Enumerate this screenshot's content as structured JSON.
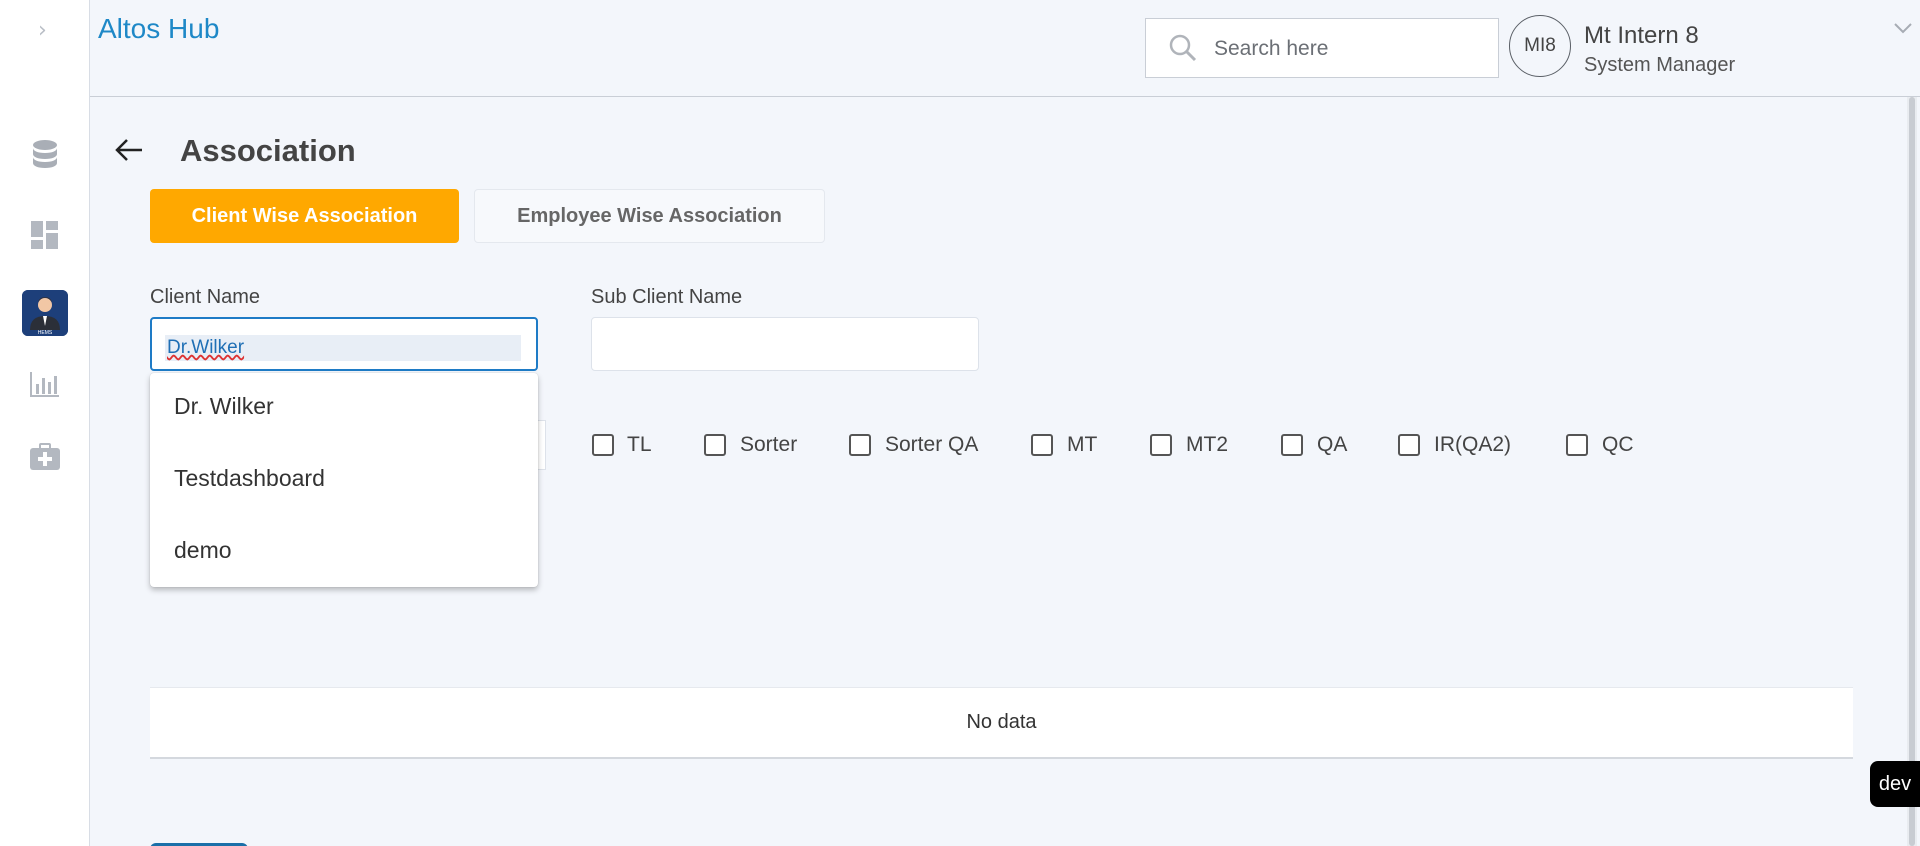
{
  "app": {
    "title": "Altos Hub"
  },
  "header": {
    "search_placeholder": "Search here",
    "user": {
      "initials": "MI8",
      "name": "Mt Intern 8",
      "role": "System Manager"
    }
  },
  "sidebar": {
    "items": [
      {
        "icon": "database-icon"
      },
      {
        "icon": "dashboard-icon"
      },
      {
        "icon": "hems-avatar-icon",
        "label": "HEMS"
      },
      {
        "icon": "bar-chart-icon"
      },
      {
        "icon": "medical-kit-icon"
      }
    ]
  },
  "page": {
    "title": "Association",
    "tabs": [
      {
        "label": "Client Wise Association",
        "active": true
      },
      {
        "label": "Employee Wise Association",
        "active": false
      }
    ]
  },
  "form": {
    "client_name_label": "Client Name",
    "client_name_value": "Dr.Wilker",
    "sub_client_label": "Sub Client Name",
    "sub_client_value": "",
    "dropdown_options": [
      "Dr. Wilker",
      "Testdashboard",
      "demo"
    ],
    "roles": [
      "TL",
      "Sorter",
      "Sorter QA",
      "MT",
      "MT2",
      "QA",
      "IR(QA2)",
      "QC"
    ]
  },
  "table": {
    "empty_text": "No data"
  },
  "badge": {
    "env": "dev"
  },
  "colors": {
    "accent": "#ffa800",
    "brand": "#1e88c7",
    "focus": "#1e7bc6"
  }
}
